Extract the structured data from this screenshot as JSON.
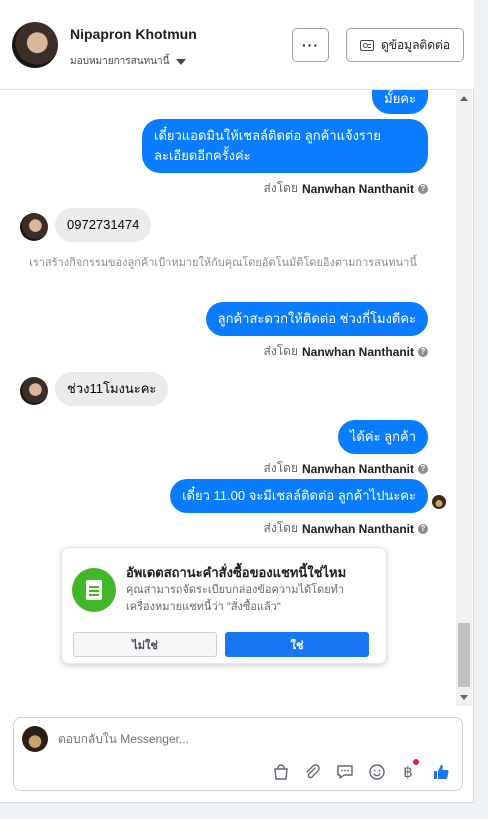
{
  "header": {
    "contact_name": "Nipapron Khotmun",
    "assign_label": "มอบหมายการสนทนานี้",
    "more_label": "···",
    "contact_info_label": "ดูข้อมูลติดต่อ"
  },
  "messages": {
    "out_partial": "มั้ยคะ",
    "out_admin_line1": "เดี๋ยวแอดมินให้เชลล์ติดต่อ ลูกค้าแจ้งราย",
    "out_admin_line2": "ละเอียดอีกครั้งค่ะ",
    "sent_prefix": "ส่งโดย",
    "sender_name": "Nanwhan Nanthanit",
    "in_phone": "0972731474",
    "system_note": "เราสร้างกิจกรรมของลูกค้าเป้าหมายให้กับคุณโดยอัตโนมัติโดยอิงตามการสนทนานี้",
    "out_convenient": "ลูกค้าสะดวกให้ติดต่อ ช่วงกี่โมงดีคะ",
    "in_time": "ช่วง11โมงนะคะ",
    "out_ok": "ได้ค่ะ ลูกค้า",
    "out_1100": "เดี๋ยว 11.00 จะมีเชลล์ติดต่อ ลูกค้าไปนะคะ"
  },
  "order_prompt": {
    "title": "อัพเดตสถานะคำสั่งซื้อของแชทนี้ใช่ไหม",
    "description": "คุณสามารถจัดระเบียบกล่องข้อความได้โดยทำเครื่องหมายแชทนี้ว่า \"สั่งซื้อแล้ว\"",
    "no_label": "ไม่ใช่",
    "yes_label": "ใช่"
  },
  "composer": {
    "placeholder": "ตอบกลับใน Messenger..."
  },
  "icons": {
    "baht": "฿"
  },
  "colors": {
    "outgoing_bubble": "#0a7cff",
    "primary_button": "#1877f2",
    "order_icon": "#42b72a",
    "like": "#1877f2",
    "notification_dot": "#e41e3f"
  }
}
